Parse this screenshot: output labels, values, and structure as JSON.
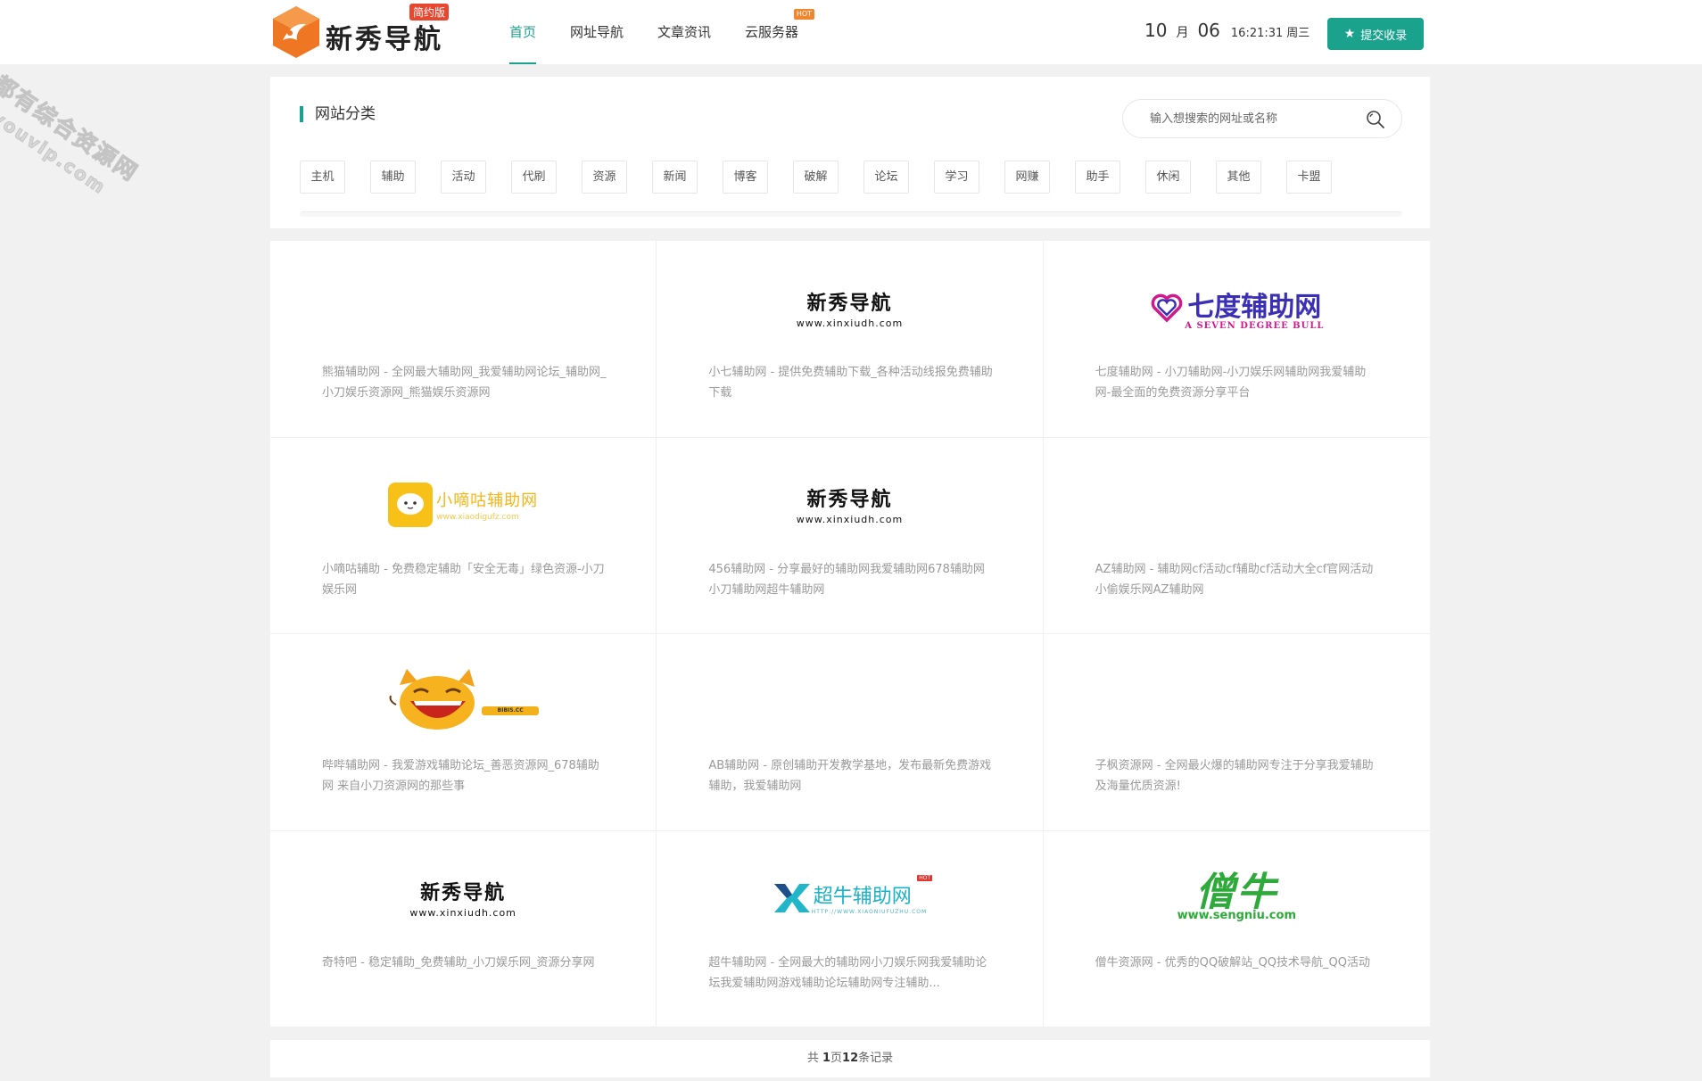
{
  "header": {
    "logo_text": "新秀导航",
    "logo_badge": "简约版",
    "nav": [
      {
        "label": "首页",
        "active": true
      },
      {
        "label": "网址导航"
      },
      {
        "label": "文章资讯"
      },
      {
        "label": "云服务器",
        "badge": "HOT"
      }
    ],
    "date": {
      "month": "10",
      "month_unit": "月",
      "day": "06",
      "time": "16:21:31",
      "weekday": "周三"
    },
    "submit_label": "提交收录",
    "accent_color": "#1aa28d"
  },
  "categories": {
    "title": "网站分类",
    "search_placeholder": "输入想搜索的网址或名称",
    "tags": [
      "主机",
      "辅助",
      "活动",
      "代刷",
      "资源",
      "新闻",
      "博客",
      "破解",
      "论坛",
      "学习",
      "网赚",
      "助手",
      "休闲",
      "其他",
      "卡盟"
    ]
  },
  "cards": [
    {
      "logo": "",
      "desc": "熊猫辅助网 - 全网最大辅助网_我爱辅助网论坛_辅助网_小刀娱乐资源网_熊猫娱乐资源网"
    },
    {
      "logo": "xinxiu",
      "logo_big": "新秀导航",
      "logo_small": "www.xinxiudh.com",
      "desc": "小七辅助网 - 提供免费辅助下载_各种活动线报免费辅助下载"
    },
    {
      "logo": "qidu",
      "logo_big": "七度辅助网",
      "logo_small": "A SEVEN DEGREE BULL",
      "desc": "七度辅助网 - 小刀辅助网-小刀娱乐网辅助网我爱辅助网-最全面的免费资源分享平台"
    },
    {
      "logo": "xiaodigu",
      "logo_big": "小嘀咕辅助网",
      "logo_small": "www.xiaodigufz.com",
      "desc": "小嘀咕辅助 - 免费稳定辅助「安全无毒」绿色资源-小刀娱乐网"
    },
    {
      "logo": "xinxiu",
      "logo_big": "新秀导航",
      "logo_small": "www.xinxiudh.com",
      "desc": "456辅助网 - 分享最好的辅助网我爱辅助网678辅助网小刀辅助网超牛辅助网"
    },
    {
      "logo": "",
      "desc": "AZ辅助网 - 辅助网cf活动cf辅助cf活动大全cf官网活动小偷娱乐网AZ辅助网"
    },
    {
      "logo": "bibi",
      "logo_small": "BIBIS.CC",
      "desc": "哔哔辅助网 - 我爱游戏辅助论坛_善恶资源网_678辅助网 来自小刀资源网的那些事"
    },
    {
      "logo": "",
      "desc": "AB辅助网 - 原创辅助开发教学基地，发布最新免费游戏辅助，我爱辅助网"
    },
    {
      "logo": "",
      "desc": "子枫资源网 - 全网最火爆的辅助网专注于分享我爱辅助及海量优质资源!"
    },
    {
      "logo": "xinxiu",
      "logo_big": "新秀导航",
      "logo_small": "www.xinxiudh.com",
      "desc": "奇特吧 - 稳定辅助_免费辅助_小刀娱乐网_资源分享网"
    },
    {
      "logo": "chaoniu",
      "logo_big": "超牛辅助网",
      "logo_small": "HTTP://WWW.XIAONIUFUZHU.COM",
      "logo_badge": "HOT",
      "desc": "超牛辅助网 - 全网最大的辅助网小刀娱乐网我爱辅助论坛我爱辅助网游戏辅助论坛辅助网专注辅助..."
    },
    {
      "logo": "sengniu",
      "logo_big": "僧牛",
      "logo_small": "www.sengniu.com",
      "desc": "僧牛资源网 - 优秀的QQ破解站_QQ技术导航_QQ活动"
    }
  ],
  "pager": {
    "prefix": "共 ",
    "pages": "1",
    "mid": "页",
    "records": "12",
    "suffix": "条记录"
  },
  "watermark": {
    "line1": "全都有综合资源网",
    "line2": "douyouvip.com"
  }
}
